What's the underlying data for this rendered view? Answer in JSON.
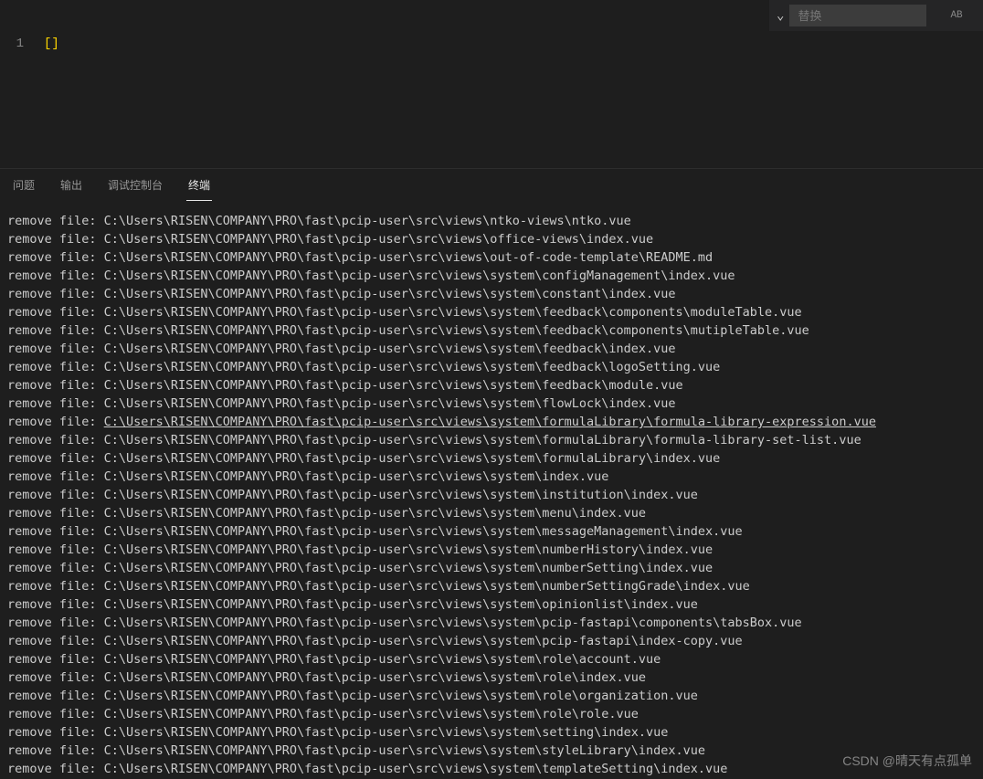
{
  "replace": {
    "placeholder": "替换",
    "caseIcon": "AB"
  },
  "editor": {
    "lineNumber": "1",
    "codeContent": "[]"
  },
  "panel": {
    "tabs": {
      "problems": "问题",
      "output": "输出",
      "debugConsole": "调试控制台",
      "terminal": "终端"
    }
  },
  "terminal": {
    "prefix": "remove file: ",
    "linkedIndex": 11,
    "paths": [
      "C:\\Users\\RISEN\\COMPANY\\PRO\\fast\\pcip-user\\src\\views\\ntko-views\\ntko.vue",
      "C:\\Users\\RISEN\\COMPANY\\PRO\\fast\\pcip-user\\src\\views\\office-views\\index.vue",
      "C:\\Users\\RISEN\\COMPANY\\PRO\\fast\\pcip-user\\src\\views\\out-of-code-template\\README.md",
      "C:\\Users\\RISEN\\COMPANY\\PRO\\fast\\pcip-user\\src\\views\\system\\configManagement\\index.vue",
      "C:\\Users\\RISEN\\COMPANY\\PRO\\fast\\pcip-user\\src\\views\\system\\constant\\index.vue",
      "C:\\Users\\RISEN\\COMPANY\\PRO\\fast\\pcip-user\\src\\views\\system\\feedback\\components\\moduleTable.vue",
      "C:\\Users\\RISEN\\COMPANY\\PRO\\fast\\pcip-user\\src\\views\\system\\feedback\\components\\mutipleTable.vue",
      "C:\\Users\\RISEN\\COMPANY\\PRO\\fast\\pcip-user\\src\\views\\system\\feedback\\index.vue",
      "C:\\Users\\RISEN\\COMPANY\\PRO\\fast\\pcip-user\\src\\views\\system\\feedback\\logoSetting.vue",
      "C:\\Users\\RISEN\\COMPANY\\PRO\\fast\\pcip-user\\src\\views\\system\\feedback\\module.vue",
      "C:\\Users\\RISEN\\COMPANY\\PRO\\fast\\pcip-user\\src\\views\\system\\flowLock\\index.vue",
      "C:\\Users\\RISEN\\COMPANY\\PRO\\fast\\pcip-user\\src\\views\\system\\formulaLibrary\\formula-library-expression.vue",
      "C:\\Users\\RISEN\\COMPANY\\PRO\\fast\\pcip-user\\src\\views\\system\\formulaLibrary\\formula-library-set-list.vue",
      "C:\\Users\\RISEN\\COMPANY\\PRO\\fast\\pcip-user\\src\\views\\system\\formulaLibrary\\index.vue",
      "C:\\Users\\RISEN\\COMPANY\\PRO\\fast\\pcip-user\\src\\views\\system\\index.vue",
      "C:\\Users\\RISEN\\COMPANY\\PRO\\fast\\pcip-user\\src\\views\\system\\institution\\index.vue",
      "C:\\Users\\RISEN\\COMPANY\\PRO\\fast\\pcip-user\\src\\views\\system\\menu\\index.vue",
      "C:\\Users\\RISEN\\COMPANY\\PRO\\fast\\pcip-user\\src\\views\\system\\messageManagement\\index.vue",
      "C:\\Users\\RISEN\\COMPANY\\PRO\\fast\\pcip-user\\src\\views\\system\\numberHistory\\index.vue",
      "C:\\Users\\RISEN\\COMPANY\\PRO\\fast\\pcip-user\\src\\views\\system\\numberSetting\\index.vue",
      "C:\\Users\\RISEN\\COMPANY\\PRO\\fast\\pcip-user\\src\\views\\system\\numberSettingGrade\\index.vue",
      "C:\\Users\\RISEN\\COMPANY\\PRO\\fast\\pcip-user\\src\\views\\system\\opinionlist\\index.vue",
      "C:\\Users\\RISEN\\COMPANY\\PRO\\fast\\pcip-user\\src\\views\\system\\pcip-fastapi\\components\\tabsBox.vue",
      "C:\\Users\\RISEN\\COMPANY\\PRO\\fast\\pcip-user\\src\\views\\system\\pcip-fastapi\\index-copy.vue",
      "C:\\Users\\RISEN\\COMPANY\\PRO\\fast\\pcip-user\\src\\views\\system\\role\\account.vue",
      "C:\\Users\\RISEN\\COMPANY\\PRO\\fast\\pcip-user\\src\\views\\system\\role\\index.vue",
      "C:\\Users\\RISEN\\COMPANY\\PRO\\fast\\pcip-user\\src\\views\\system\\role\\organization.vue",
      "C:\\Users\\RISEN\\COMPANY\\PRO\\fast\\pcip-user\\src\\views\\system\\role\\role.vue",
      "C:\\Users\\RISEN\\COMPANY\\PRO\\fast\\pcip-user\\src\\views\\system\\setting\\index.vue",
      "C:\\Users\\RISEN\\COMPANY\\PRO\\fast\\pcip-user\\src\\views\\system\\styleLibrary\\index.vue",
      "C:\\Users\\RISEN\\COMPANY\\PRO\\fast\\pcip-user\\src\\views\\system\\templateSetting\\index.vue"
    ]
  },
  "watermark": "CSDN @晴天有点孤单"
}
